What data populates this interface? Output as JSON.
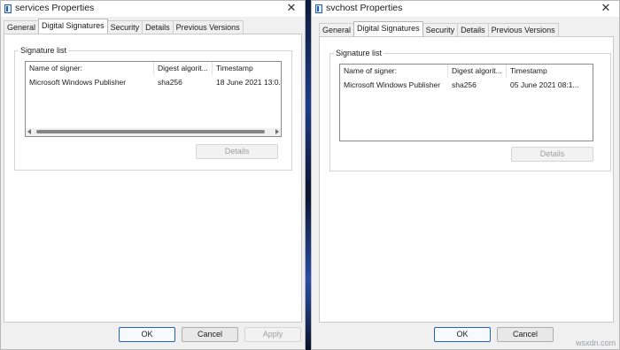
{
  "left_window": {
    "title": "services Properties",
    "tabs": [
      "General",
      "Digital Signatures",
      "Security",
      "Details",
      "Previous Versions"
    ],
    "active_tab": "Digital Signatures",
    "signature_list_label": "Signature list",
    "columns": [
      "Name of signer:",
      "Digest algorit...",
      "Timestamp"
    ],
    "rows": [
      {
        "name": "Microsoft Windows Publisher",
        "digest": "sha256",
        "timestamp": "18 June 2021 13:0..."
      }
    ],
    "details_button": "Details",
    "ok_button": "OK",
    "cancel_button": "Cancel",
    "apply_button": "Apply"
  },
  "right_window": {
    "title": "svchost Properties",
    "tabs": [
      "General",
      "Digital Signatures",
      "Security",
      "Details",
      "Previous Versions"
    ],
    "active_tab": "Digital Signatures",
    "signature_list_label": "Signature list",
    "columns": [
      "Name of signer:",
      "Digest algorit...",
      "Timestamp"
    ],
    "rows": [
      {
        "name": "Microsoft Windows Publisher",
        "digest": "sha256",
        "timestamp": "05 June 2021 08:1..."
      }
    ],
    "details_button": "Details",
    "ok_button": "OK",
    "cancel_button": "Cancel"
  },
  "close_glyph": "✕",
  "watermark": "wsxdn.com",
  "colors": {
    "desktop": "#0b1630",
    "dialog": "#f0f0f0",
    "default_button_border": "#1e63c4"
  },
  "icons": [
    "properties-icon",
    "close-icon",
    "scroll-left-icon",
    "scroll-right-icon"
  ]
}
